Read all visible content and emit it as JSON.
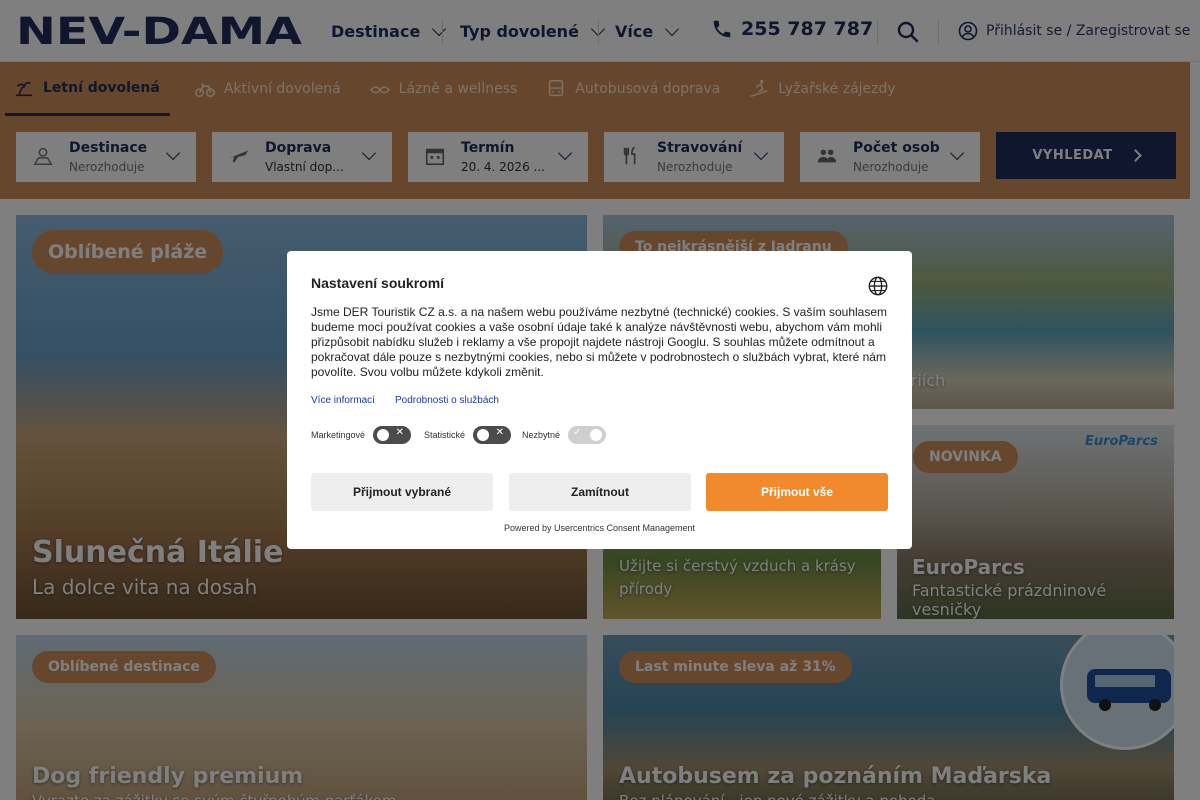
{
  "header": {
    "logo_text": "NEV-DAMA",
    "nav": [
      "Destinace",
      "Typ dovolené",
      "Více"
    ],
    "phone": "255 787 787",
    "login": "Přihlásit se / Zaregistrovat se"
  },
  "tabs": [
    {
      "label": "Letní dovolená",
      "icon": "beach-icon",
      "active": true
    },
    {
      "label": "Aktivní dovolená",
      "icon": "bicycle-icon",
      "active": false
    },
    {
      "label": "Lázně a wellness",
      "icon": "spa-icon",
      "active": false
    },
    {
      "label": "Autobusová doprava",
      "icon": "bus-icon",
      "active": false
    },
    {
      "label": "Lyžařské zájezdy",
      "icon": "ski-icon",
      "active": false
    }
  ],
  "search": {
    "fields": [
      {
        "title": "Destinace",
        "value": "Nerozhoduje",
        "icon": "location-icon"
      },
      {
        "title": "Doprava",
        "value": "Vlastní dop...",
        "icon": "plane-icon"
      },
      {
        "title": "Termín",
        "value": "20. 4. 2026 ...",
        "icon": "calendar-icon"
      },
      {
        "title": "Stravování",
        "value": "Nerozhoduje",
        "icon": "cutlery-icon"
      },
      {
        "title": "Počet osob",
        "value": "Nerozhoduje",
        "icon": "people-icon"
      }
    ],
    "button": "VYHLEDAT"
  },
  "cards": {
    "italy": {
      "badge": "Oblíbené pláže",
      "title": "Slunečná Itálie",
      "subtitle": "La dolce vita na dosah"
    },
    "adriatic": {
      "badge": "To nejkrásnější z Jadranu",
      "subtitle_fragment": "eriích"
    },
    "nature": {
      "subtitle": "Užijte si čerstvý vzduch a krásy přírody"
    },
    "europarcs": {
      "badge": "NOVINKA",
      "logo": "EuroParcs",
      "title": "EuroParcs",
      "subtitle": "Fantastické prázdninové vesničky"
    },
    "dog": {
      "badge": "Oblíbené destinace",
      "title": "Dog friendly premium",
      "subtitle": "Vyrazte za zážitky se svým čtyřnohým parťákem"
    },
    "hungary": {
      "badge": "Last minute sleva až 31%",
      "title": "Autobusem za poznáním Maďarska",
      "subtitle": "Bez plánování - jen nové zážitky a pohoda"
    }
  },
  "consent": {
    "title": "Nastavení soukromí",
    "text": "Jsme DER Touristik CZ a.s. a na našem webu používáme nezbytné (technické) cookies. S vaším souhlasem budeme moci používat cookies a vaše osobní údaje také k analýze návštěvnosti webu, abychom vám mohli přizpůsobit nabídku služeb i reklamy a vše propojit najdete nástroji Googlu. S souhlas můžete odmítnout a pokračovat dále pouze s nezbytnými cookies, nebo si můžete v podrobnostech o službách vybrat, které nám povolíte. Svou volbu můžete kdykoli změnit.",
    "link_more": "Více informací",
    "link_details": "Podrobnosti o službách",
    "toggles": [
      {
        "label": "Marketingové",
        "state": "off"
      },
      {
        "label": "Statistické",
        "state": "off"
      },
      {
        "label": "Nezbytné",
        "state": "on"
      }
    ],
    "btn_selected": "Přijmout vybrané",
    "btn_reject": "Zamítnout",
    "btn_accept": "Přijmout vše",
    "powered": "Powered by Usercentrics Consent Management",
    "colors": {
      "accent": "#f08a2d",
      "brand": "#1f2d5a",
      "band": "#cd8f5a"
    }
  }
}
